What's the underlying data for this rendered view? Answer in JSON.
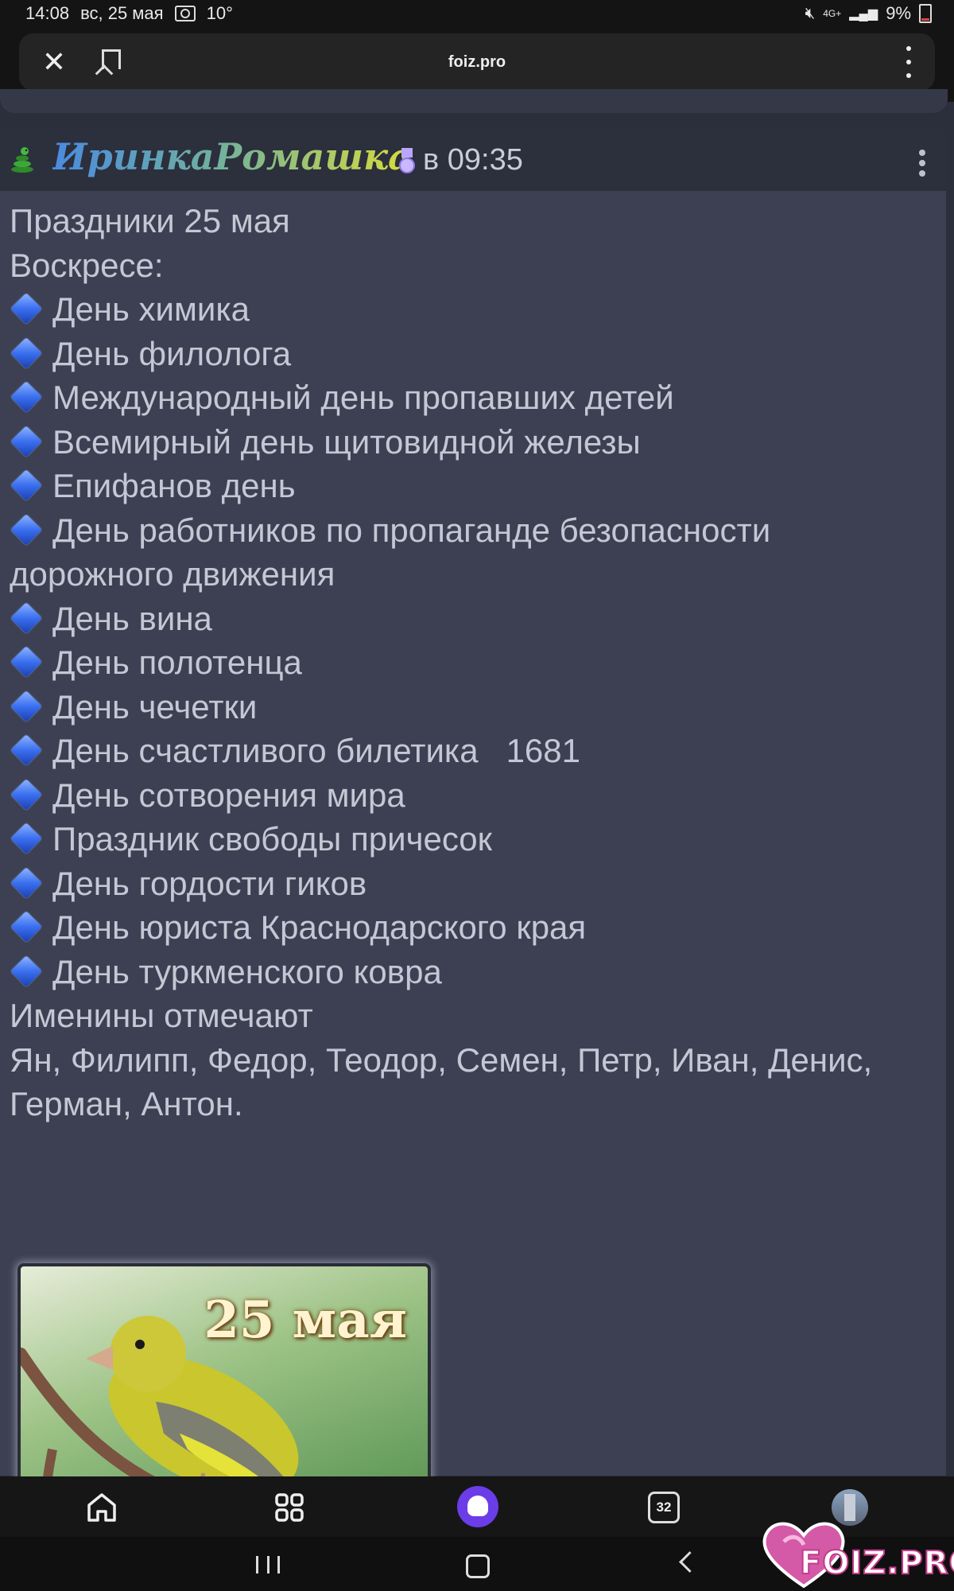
{
  "status_bar": {
    "time": "14:08",
    "date": "вс, 25 мая",
    "temperature": "10°",
    "network": "4G+",
    "battery": "9%"
  },
  "browser": {
    "url": "foiz.pro",
    "close_icon": "close-icon",
    "bookmark_icon": "bookmark-icon",
    "menu_icon": "more-vert-icon"
  },
  "post": {
    "author": "ИринкаРомашка",
    "time": "в 09:35",
    "author_gradient": [
      "#4a8be0",
      "#d8dc3a"
    ],
    "heading": "Праздники 25 мая",
    "weekday": "Воскресе:",
    "holidays": [
      "День химика",
      "День филолога",
      "Международный день пропавших детей",
      "Всемирный день щитовидной железы",
      "Епифанов день",
      "День работников по пропаганде безопасности дорожного движения",
      "День вина",
      "День полотенца",
      "День чечетки",
      "День счастливого билетика   1681",
      "День сотворения мира",
      "Праздник свободы причесок",
      "День гордости гиков",
      "День юриста Краснодарского края",
      "День туркменского ковра"
    ],
    "namedays_title": "Именины отмечают",
    "namedays": "Ян, Филипп, Федор, Теодор, Семен, Петр, Иван, Денис, Герман, Антон.",
    "image_caption": "25 мая",
    "bullet_color": "#3a6ff0"
  },
  "bottom_nav": {
    "items": [
      "home-icon",
      "apps-grid-icon",
      "assistant-icon",
      "tabs-icon",
      "profile-avatar"
    ],
    "tabs_count": "32",
    "accent": "#6a3de8"
  },
  "watermark": {
    "text": "FOIZ.PRO"
  }
}
